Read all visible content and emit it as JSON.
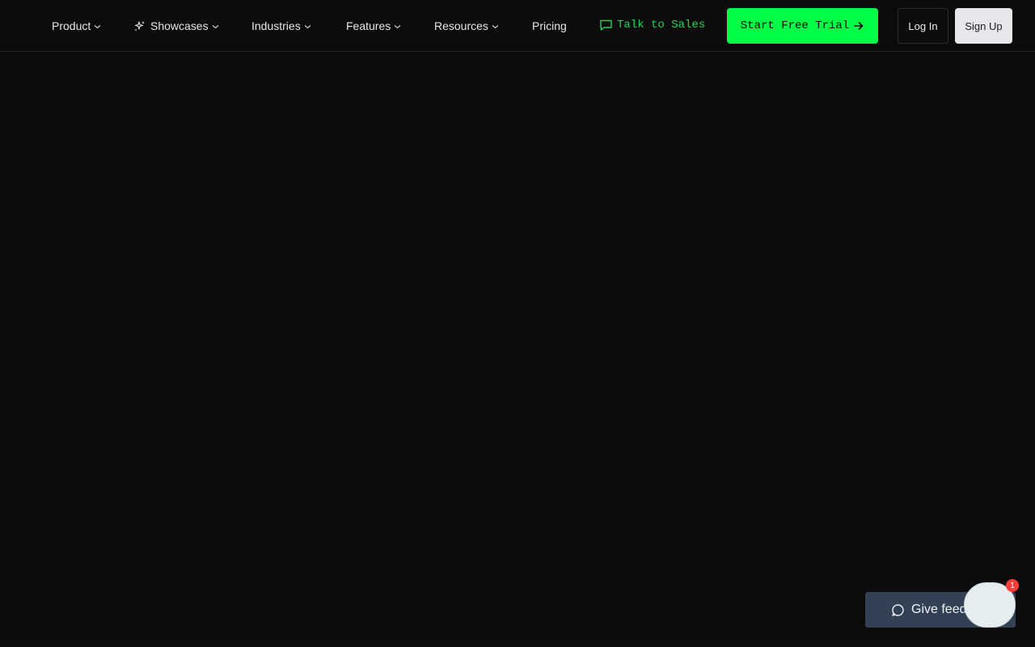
{
  "nav": {
    "items": [
      {
        "label": "Product",
        "has_dropdown": true
      },
      {
        "label": "Showcases",
        "has_dropdown": true,
        "icon": "sparkles-icon"
      },
      {
        "label": "Industries",
        "has_dropdown": true
      },
      {
        "label": "Features",
        "has_dropdown": true
      },
      {
        "label": "Resources",
        "has_dropdown": true
      },
      {
        "label": "Pricing",
        "has_dropdown": false
      }
    ],
    "talk_to_sales": {
      "label": "Talk to Sales",
      "icon": "chat-bubble-icon"
    },
    "start_trial": {
      "label": "Start Free Trial",
      "icon": "arrow-right-icon"
    },
    "login": {
      "label": "Log In"
    },
    "signup": {
      "label": "Sign Up"
    }
  },
  "widgets": {
    "feedback": {
      "label": "Give feedback",
      "icon": "chat-bubble-icon"
    },
    "chat_badge_count": "1"
  },
  "colors": {
    "background": "#0c0c0c",
    "accent_green": "#00ff47",
    "sales_green": "#22d35a",
    "feedback_bg": "#334155",
    "badge_red": "#ff3b3b"
  }
}
